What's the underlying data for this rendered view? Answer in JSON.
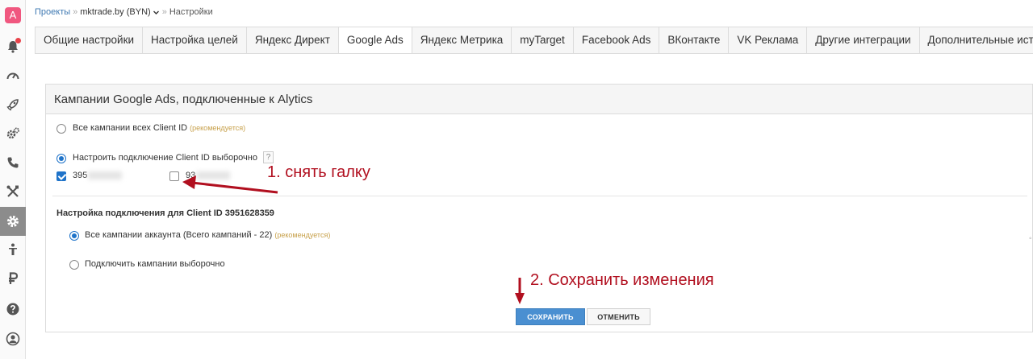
{
  "sidebar": {
    "logo": "A",
    "items": [
      {
        "name": "notifications-icon"
      },
      {
        "name": "dashboard-gauge-icon"
      },
      {
        "name": "rocket-icon"
      },
      {
        "name": "settings-gears-icon"
      },
      {
        "name": "phone-icon"
      },
      {
        "name": "tools-icon"
      },
      {
        "name": "settings-gear-icon",
        "active": true
      },
      {
        "name": "person-icon"
      },
      {
        "name": "ruble-icon"
      },
      {
        "name": "help-icon"
      },
      {
        "name": "account-icon"
      }
    ]
  },
  "breadcrumb": {
    "projects": "Проекты",
    "sep": "»",
    "project": "mktrade.by (BYN)",
    "current": "Настройки"
  },
  "tabs": [
    "Общие настройки",
    "Настройка целей",
    "Яндекс Директ",
    "Google Ads",
    "Яндекс Метрика",
    "myTarget",
    "Facebook Ads",
    "ВКонтакте",
    "VK Реклама",
    "Другие интеграции",
    "Дополнительные источники"
  ],
  "active_tab": "Google Ads",
  "panel": {
    "title": "Кампании Google Ads, подключенные к Alytics",
    "all_campaigns_label": "Все кампании всех Client ID",
    "recommended": "(рекомендуется)",
    "selective_label": "Настроить подключение Client ID выборочно",
    "help": "?",
    "client_1": "395",
    "client_2": "93",
    "connection_heading": "Настройка подключения для Client ID 3951628359",
    "all_account_campaigns": "Все кампании аккаунта (Всего кампаний - 22)",
    "recommended_alt": "(рекомендуется)",
    "connect_selective": "Подключить кампании выборочно",
    "save": "СОХРАНИТЬ",
    "cancel": "ОТМЕНИТЬ"
  },
  "annotations": {
    "step1": "1. снять галку",
    "step2": "2. Сохранить изменения",
    "color": "#b10f1f"
  },
  "colors": {
    "accent": "#1f73c9",
    "save_button": "#4a8fd1",
    "logo": "#f0577f"
  }
}
